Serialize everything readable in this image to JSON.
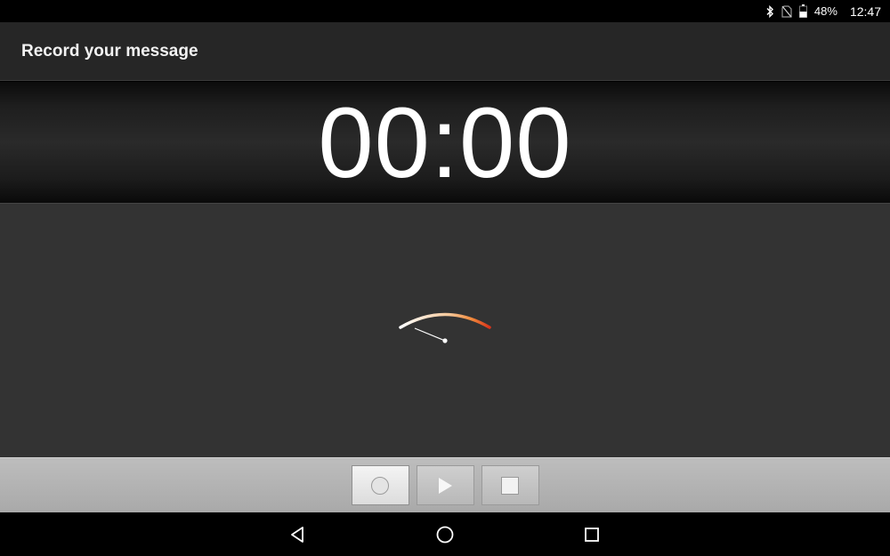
{
  "status_bar": {
    "icons": [
      "bluetooth-icon",
      "no-sim-icon",
      "battery-icon"
    ],
    "battery_text": "48%",
    "time": "12:47"
  },
  "action_bar": {
    "title": "Record your message"
  },
  "timer": {
    "display": "00:00"
  },
  "vu_meter": {
    "level": 0,
    "colors": {
      "low": "#ffffff",
      "mid": "#f5a05a",
      "high": "#d9341a"
    }
  },
  "controls": {
    "buttons": [
      {
        "icon": "record-icon",
        "active": true
      },
      {
        "icon": "play-icon",
        "active": false
      },
      {
        "icon": "stop-icon",
        "active": false
      }
    ]
  },
  "nav_bar": {
    "buttons": [
      "back-icon",
      "home-icon",
      "recents-icon"
    ]
  }
}
